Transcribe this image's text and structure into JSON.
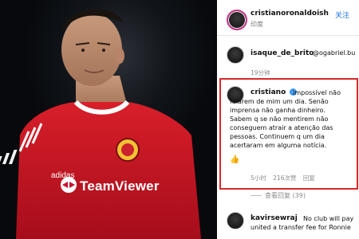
{
  "post": {
    "author_username": "cristianoronaldoish",
    "follow_label": "关注",
    "location": "印度"
  },
  "comments": [
    {
      "username": "isaque_de_brito",
      "text_preview": "@ogabriel.bu"
    },
    {
      "timestamp": "19分钟"
    }
  ],
  "highlighted_comment": {
    "username": "cristiano",
    "verified_icon": "verified-check-icon",
    "lines": [
      "Impossível não",
      "falarem de mim um dia. Senão",
      "imprensa não ganha dinheiro.",
      "Sabem q se não mentirem não",
      "conseguem atrair a atenção das",
      "pessoas. Continuem q um dia",
      "acertaram em alguma notícia."
    ],
    "emoji": "👍",
    "time_ago": "5小时",
    "likes": "216次赞",
    "reply_label": "回复"
  },
  "view_replies_label": "查看回复 (39)",
  "bottom_comment": {
    "username": "kavirsewraj",
    "lines": [
      "No club will pay",
      "united a transfer fee for Ronnie"
    ]
  },
  "photo": {
    "sponsor_text": "TeamViewer"
  },
  "colors": {
    "accent_blue": "#1a73e8",
    "highlight_red": "#d62929",
    "verified_blue": "#3897f0",
    "jersey_red": "#c8102e"
  }
}
